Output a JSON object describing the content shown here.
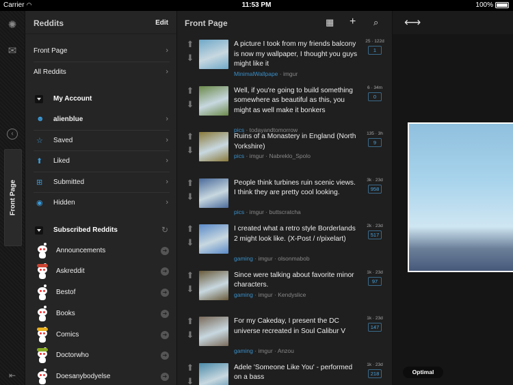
{
  "status_bar": {
    "carrier": "Carrier",
    "time": "11:53 PM",
    "battery": "100%"
  },
  "rail": {
    "tab_label": "Front Page"
  },
  "reddits": {
    "title": "Reddits",
    "edit_label": "Edit",
    "top_items": [
      {
        "label": "Front Page"
      },
      {
        "label": "All Reddits"
      }
    ],
    "account_section": "My Account",
    "account_items": [
      {
        "label": "alienblue",
        "icon": "alien-icon"
      },
      {
        "label": "Saved",
        "icon": "star-icon"
      },
      {
        "label": "Liked",
        "icon": "up-arrow-icon"
      },
      {
        "label": "Submitted",
        "icon": "submit-icon"
      },
      {
        "label": "Hidden",
        "icon": "eye-icon"
      }
    ],
    "subscribed_section": "Subscribed Reddits",
    "subscribed": [
      {
        "label": "Announcements",
        "hat": ""
      },
      {
        "label": "Askreddit",
        "hat": "#c43"
      },
      {
        "label": "Bestof",
        "hat": ""
      },
      {
        "label": "Books",
        "hat": ""
      },
      {
        "label": "Comics",
        "hat": "#e8b020"
      },
      {
        "label": "Doctorwho",
        "hat": "#8a2"
      },
      {
        "label": "Doesanybodyelse",
        "hat": ""
      }
    ]
  },
  "front": {
    "title": "Front Page",
    "posts": [
      {
        "title": "A picture I took from my friends balcony is now my wallpaper, I thought you guys might like it",
        "sub": "MinimalWallpape",
        "meta": " · imgur",
        "score_age": "25 · 122d",
        "comments": "1",
        "thumb": "#6fa8c8"
      },
      {
        "title": "Well, if you're going to build something somewhere as beautiful as this, you might as well make it bonkers",
        "sub": "pics",
        "meta": " · todayandtomorrow",
        "score_age": "6 · 34m",
        "comments": "0",
        "thumb": "#6c8a4a"
      },
      {
        "title": "Ruins of a Monastery in England (North Yorkshire)",
        "sub": "pics",
        "meta": " · imgur · Nabreklo_Spolo",
        "score_age": "135 · 3h",
        "comments": "9",
        "thumb": "#8a7a3a"
      },
      {
        "title": "People think turbines ruin scenic views. I think they are pretty cool looking.",
        "sub": "pics",
        "meta": " · imgur · buttscratcha",
        "score_age": "3k · 23d",
        "comments": "958",
        "thumb": "#4a6a9a"
      },
      {
        "title": "I created what a retro style Borderlands 2 might look like. (X-Post / r/pixelart)",
        "sub": "gaming",
        "meta": " · imgur · olsonmabob",
        "score_age": "2k · 23d",
        "comments": "517",
        "thumb": "#5a8ac8"
      },
      {
        "title": "Since were talking about favorite minor characters.",
        "sub": "gaming",
        "meta": " · imgur · Kendyslice",
        "score_age": "1k · 23d",
        "comments": "97",
        "thumb": "#6a5a3a"
      },
      {
        "title": "For my Cakeday, I present the DC universe recreated in Soul Calibur V",
        "sub": "gaming",
        "meta": " · imgur · Anzou",
        "score_age": "1k · 23d",
        "comments": "147",
        "thumb": "#7a6a5a"
      },
      {
        "title": "Adele 'Someone Like You' - performed on a bass",
        "sub": "videos",
        "meta": " · youtube · ZanderZon",
        "score_age": "1k · 23d",
        "comments": "218",
        "thumb": "#4a8aa8"
      }
    ]
  },
  "detail": {
    "optimal_label": "Optimal"
  }
}
